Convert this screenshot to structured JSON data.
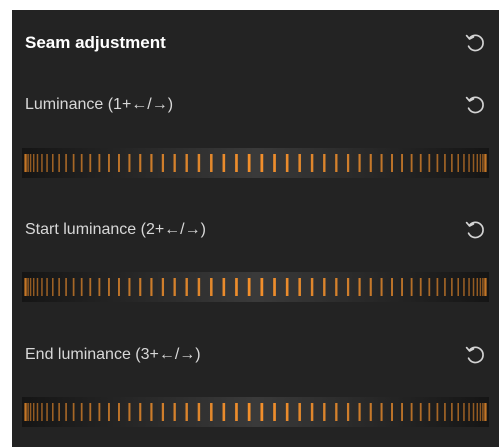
{
  "panel": {
    "title": "Seam adjustment",
    "reset_icon": "reset-rotate-icon",
    "accent_color": "#f5912c",
    "background_color": "#232323"
  },
  "controls": [
    {
      "label": "Luminance (1+←/→)",
      "reset_icon": "reset-rotate-icon"
    },
    {
      "label": "Start luminance (2+←/→)",
      "reset_icon": "reset-rotate-icon"
    },
    {
      "label": "End luminance (3+←/→)",
      "reset_icon": "reset-rotate-icon"
    }
  ]
}
